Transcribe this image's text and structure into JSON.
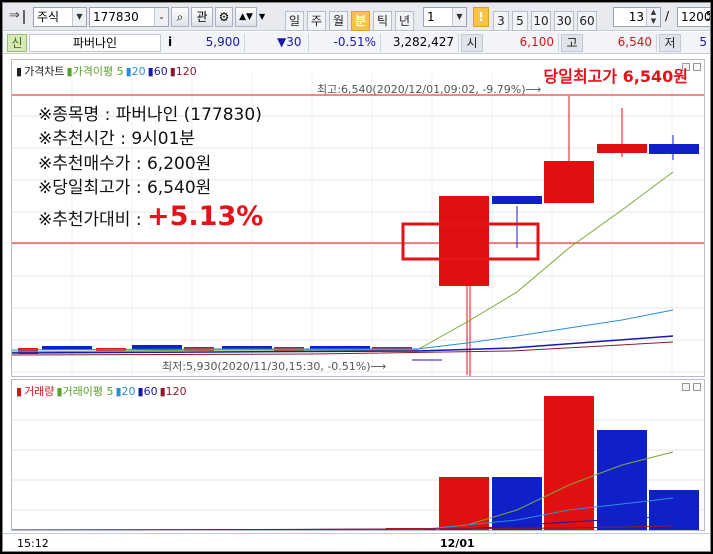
{
  "toolbar": {
    "market": "주식",
    "code": "177830",
    "btn_search": "⌕",
    "btn_interest": "관",
    "periods": [
      "일",
      "주",
      "월",
      "분",
      "틱",
      "년"
    ],
    "active_period": "분",
    "interval": "1",
    "minute_presets": [
      "3",
      "5",
      "10",
      "30",
      "60"
    ],
    "highlight_preset": "!",
    "count_value": "13",
    "total_value": "1200",
    "slash": "/",
    "extra": "5"
  },
  "quote": {
    "badge": "신",
    "name": "파버나인",
    "info_icon": "i",
    "price": "5,900",
    "change": "▼30",
    "change_pct": "-0.51%",
    "volume": "3,282,427",
    "open_label": "시",
    "open": "6,100",
    "high_label": "고",
    "high": "6,540",
    "low_label": "저",
    "low": "5"
  },
  "price_pane": {
    "legend": [
      {
        "text": "가격차트",
        "color": "#222222"
      },
      {
        "text": "가격이평 5",
        "color": "#5aa02c"
      },
      {
        "text": "20",
        "color": "#2a8fd6"
      },
      {
        "text": "60",
        "color": "#1a1aa8"
      },
      {
        "text": "120",
        "color": "#8b1a2e"
      }
    ],
    "high_banner": "당일최고가 6,540원",
    "max_mark": "최고:6,540(2020/12/01,09:02, -9.79%)⟶",
    "min_mark": "최저:5,930(2020/11/30,15:30, -0.51%)⟶",
    "notes": {
      "name": "※종목명 : 파버나인 (177830)",
      "time": "※추천시간 : 9시01분",
      "buy": "※추천매수가 : 6,200원",
      "high": "※당일최고가 : 6,540원",
      "ratio_label": "※추천가대비 : ",
      "ratio_value": "+5.13%"
    }
  },
  "volume_pane": {
    "legend": [
      {
        "text": "거래량",
        "color": "#d01818"
      },
      {
        "text": "거래이평 5",
        "color": "#5aa02c"
      },
      {
        "text": "20",
        "color": "#2a8fd6"
      },
      {
        "text": "60",
        "color": "#1a1aa8"
      },
      {
        "text": "120",
        "color": "#8b1a2e"
      }
    ]
  },
  "x_axis": {
    "left_label": "15:12",
    "date_label": "12/01"
  },
  "colors": {
    "up": "#e01010",
    "down": "#1020c8",
    "ma5": "#7aa83a",
    "ma20": "#2a8fd6",
    "ma60": "#1a1aa8",
    "ma120": "#8b1a2e",
    "highlight": "#e5121a"
  }
}
